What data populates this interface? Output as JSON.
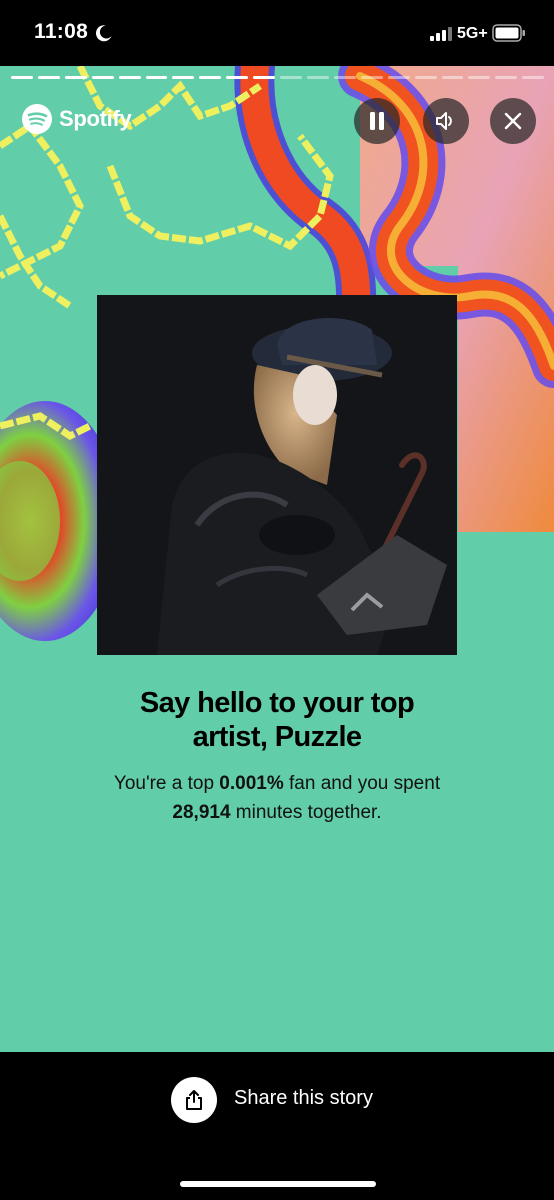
{
  "status": {
    "time": "11:08",
    "network": "5G+"
  },
  "story": {
    "segments_total": 20,
    "segments_done": 10,
    "brand": "Spotify",
    "headline_line1": "Say hello to your top",
    "headline_line2": "artist, Puzzle",
    "sub_prefix": "You're a top ",
    "sub_percent": "0.001%",
    "sub_mid": " fan and you spent",
    "sub_minutes": "28,914",
    "sub_suffix": " minutes together.",
    "background_color": "#62cda9"
  },
  "footer": {
    "share_label": "Share this story"
  }
}
